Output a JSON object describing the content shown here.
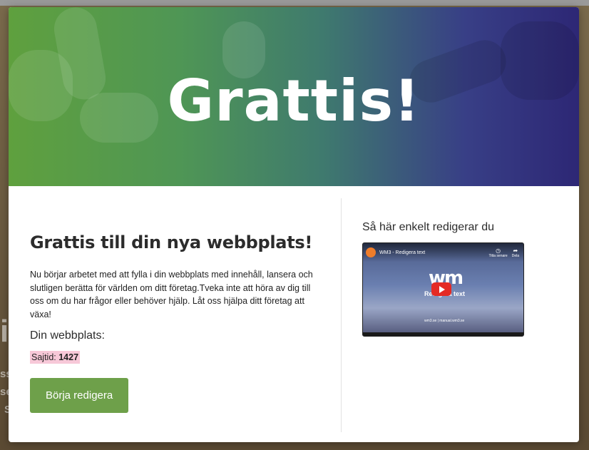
{
  "background_text": {
    "letter": "il",
    "lines": [
      "ssa",
      "se",
      "S"
    ]
  },
  "hero": {
    "title": "Grattis!"
  },
  "main": {
    "heading": "Grattis till din nya webbplats!",
    "intro": "Nu börjar arbetet med att fylla i din webbplats med innehåll, lansera och slutligen berätta för världen om ditt företag.Tveka inte att höra av dig till oss om du har frågor eller behöver hjälp. Låt oss hjälpa ditt företag att växa!",
    "site_label": "Din webbplats:",
    "site_id_label": "Sajtid:",
    "site_id_value": "1427",
    "edit_button": "Börja redigera"
  },
  "video": {
    "heading": "Så här enkelt redigerar du",
    "title": "WM3 - Redigera text",
    "watch_later": "Titta senare",
    "share": "Dela",
    "logo_text": "wm",
    "center_text": "Redigera text",
    "footer": "wm3.se | manual.wm3.se"
  },
  "colors": {
    "button_green": "#6ea04a",
    "site_id_highlight": "#f7c8d8",
    "play_red": "#e42a24"
  }
}
